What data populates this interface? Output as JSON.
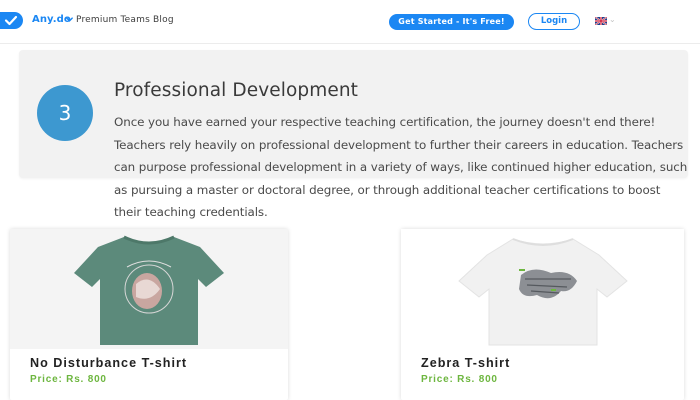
{
  "header": {
    "brand": "Any.do",
    "blog_title": "Premium Teams Blog",
    "cta_label": "Get Started - It's Free!",
    "login_label": "Login",
    "language_icon": "uk-flag-icon"
  },
  "info_card": {
    "step_number": "3",
    "title": "Professional Development",
    "body": "Once you have earned your respective teaching certification, the journey doesn't end there! Teachers rely heavily on professional development to further their careers in education. Teachers can purpose professional development in a variety of ways, like continued higher education, such as pursuing a master or doctoral degree, or through additional teacher certifications to boost their teaching credentials."
  },
  "products": [
    {
      "name": "No Disturbance T-shirt",
      "price": "Price: Rs. 800",
      "shirt_color": "#5c8a7b"
    },
    {
      "name": "Zebra T-shirt",
      "price": "Price: Rs. 800",
      "shirt_color": "#f2f2f2"
    }
  ],
  "colors": {
    "brand_blue": "#1b87f3",
    "step_circle": "#3d98d0",
    "price_green": "#6db63f"
  }
}
